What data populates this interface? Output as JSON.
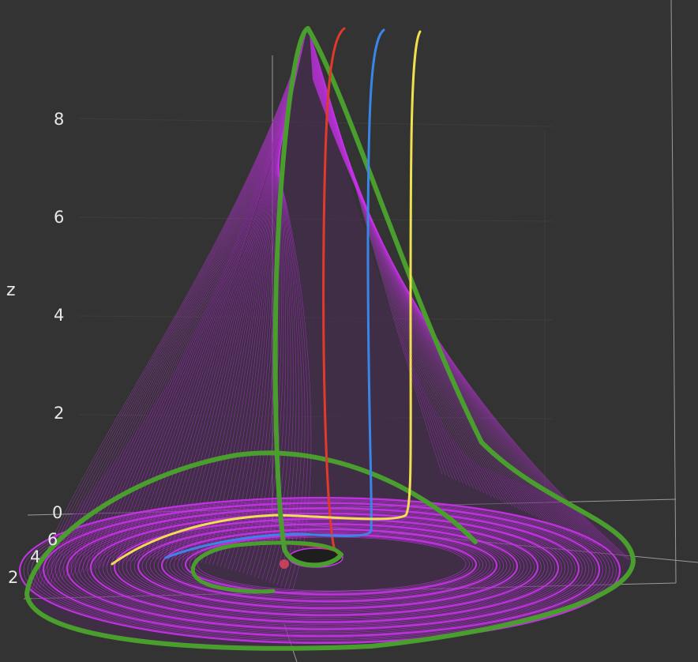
{
  "chart_data": {
    "type": "line",
    "projection": "3d",
    "background": "#333333",
    "zlabel": "z",
    "z_ticks": [
      "8",
      "6",
      "4",
      "2",
      "0"
    ],
    "y_ticks": [
      "6",
      "4",
      "2"
    ],
    "zlim": [
      0,
      9
    ],
    "grid": true,
    "legend": "none",
    "attractor_color": "#cc33ee",
    "series": [
      {
        "color": "#4a9e2e",
        "role": "long trajectory"
      },
      {
        "color": "#e23a2a",
        "role": "trajectory"
      },
      {
        "color": "#3a86e8",
        "role": "trajectory"
      },
      {
        "color": "#f0e050",
        "role": "trajectory"
      }
    ],
    "marker_color": "#d8445a"
  }
}
